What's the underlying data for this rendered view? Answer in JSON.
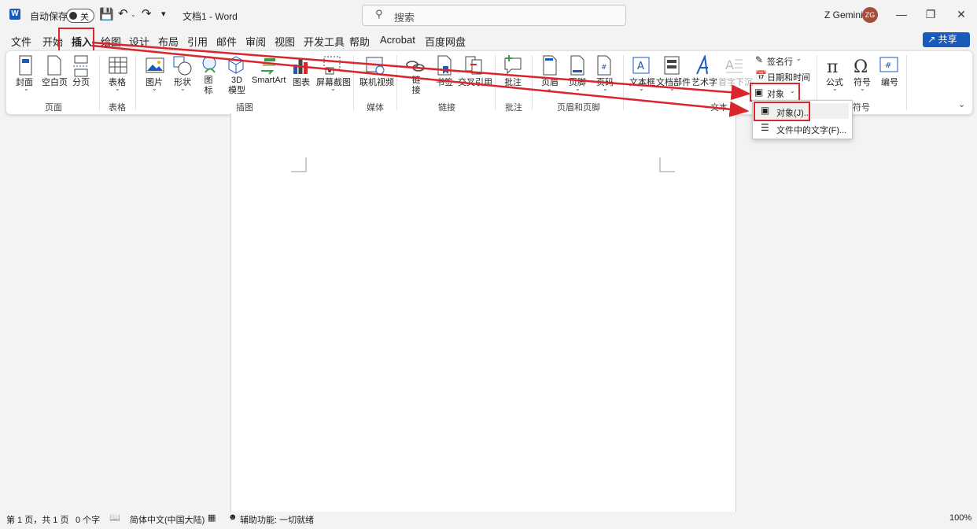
{
  "titlebar": {
    "autosave_label": "自动保存",
    "autosave_state": "关",
    "doc_title": "文档1 - Word",
    "search_placeholder": "搜索",
    "user_name": "Z Gemini",
    "user_initials": "ZG"
  },
  "tabs": [
    "文件",
    "开始",
    "插入",
    "绘图",
    "设计",
    "布局",
    "引用",
    "邮件",
    "审阅",
    "视图",
    "开发工具",
    "帮助",
    "Acrobat",
    "百度网盘"
  ],
  "share_label": "共享",
  "ribbon": {
    "buttons": [
      "封面",
      "空白页",
      "分页",
      "表格",
      "图片",
      "形状",
      "图标",
      "3D 模型",
      "SmartArt",
      "图表",
      "屏幕截图",
      "联机视频",
      "链接",
      "书签",
      "交叉引用",
      "批注",
      "页眉",
      "页脚",
      "页码",
      "文本框",
      "文档部件",
      "艺术字",
      "首字下沉",
      "公式",
      "符号",
      "编号"
    ],
    "small_buttons": [
      "签名行",
      "日期和时间",
      "对象"
    ],
    "groups": [
      "页面",
      "表格",
      "插图",
      "媒体",
      "链接",
      "批注",
      "页眉和页脚",
      "文本",
      "符号"
    ]
  },
  "menu": {
    "items": [
      "对象(J)...",
      "文件中的文字(F)..."
    ]
  },
  "status": {
    "page": "第 1 页，共 1 页",
    "words": "0 个字",
    "language": "简体中文(中国大陆)",
    "accessibility": "辅助功能: 一切就绪",
    "zoom": "100%"
  },
  "colors": {
    "accent": "#185abd",
    "highlight": "#d9262c"
  }
}
